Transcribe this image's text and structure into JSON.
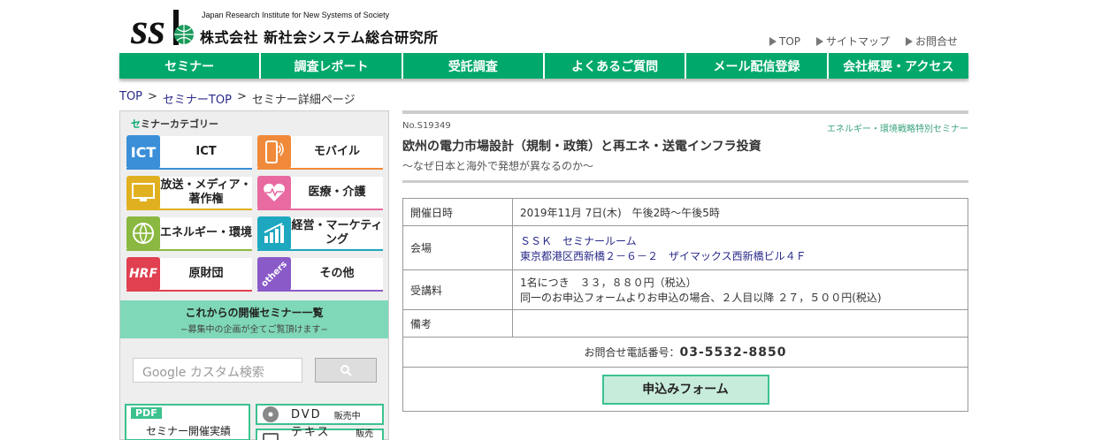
{
  "header": {
    "logo_text": "ssk",
    "org_en": "Japan Research Institute for New Systems of Society",
    "org_jp": "株式会社 新社会システム総合研究所",
    "top_links": [
      "TOP",
      "サイトマップ",
      "お問合せ"
    ]
  },
  "nav": [
    "セミナー",
    "調査レポート",
    "受託調査",
    "よくあるご質問",
    "メール配信登録",
    "会社概要・アクセス"
  ],
  "breadcrumb": {
    "items": [
      "TOP",
      "セミナーTOP",
      "セミナー詳細ページ"
    ],
    "separator": ">"
  },
  "sidebar": {
    "category_title": "セミナーカテゴリー",
    "categories": [
      {
        "label": "ICT",
        "icon": "ict-icon",
        "color": "#3a8fd8"
      },
      {
        "label": "モバイル",
        "icon": "mobile-icon",
        "color": "#f08a3a"
      },
      {
        "label": "放送・メディア・著作権",
        "icon": "monitor-icon",
        "color": "#e0b020"
      },
      {
        "label": "医療・介護",
        "icon": "heart-icon",
        "color": "#e86aa0"
      },
      {
        "label": "エネルギー・環境",
        "icon": "globe-icon",
        "color": "#8ab840"
      },
      {
        "label": "経営・マーケティング",
        "icon": "growth-chart-icon",
        "color": "#1ea8c0"
      },
      {
        "label": "原財団",
        "icon": "hrf-icon",
        "color": "#e04050"
      },
      {
        "label": "その他",
        "icon": "others-icon",
        "color": "#8a5ac8"
      }
    ],
    "upcoming_title": "これからの開催セミナー一覧",
    "upcoming_sub": "−募集中の企画が全てご覧頂けます−",
    "search_placeholder": "Google カスタム検索",
    "pdf_tag": "PDF",
    "pdf_label": "セミナー開催実績",
    "dvd_label": "DVD",
    "dvd_status": "販売中",
    "text_label": "テキスト",
    "text_status": "販売中"
  },
  "seminar": {
    "number": "No.S19349",
    "category": "エネルギー・環境戦略特別セミナー",
    "title": "欧州の電力市場設計（規制・政策）と再エネ・送電インフラ投資",
    "subtitle": "〜なぜ日本と海外で発想が異なるのか〜",
    "rows": {
      "date_label": "開催日時",
      "date_value": "2019年11月 7日(木)　午後2時〜午後5時",
      "venue_label": "会場",
      "venue_name": "ＳＳＫ　セミナールーム",
      "venue_address": "東京都港区西新橋２－６－２　ザイマックス西新橋ビル４Ｆ",
      "fee_label": "受講料",
      "fee_line1": "1名につき　３３，８８０円（税込）",
      "fee_line2": "同一のお申込フォームよりお申込の場合、２人目以降 ２７，５００円(税込)",
      "notes_label": "備考",
      "notes_value": ""
    },
    "phone_label": "お問合せ電話番号：",
    "phone_number": "03-5532-8850",
    "apply_label": "申込みフォーム"
  },
  "colors": {
    "brand_green": "#00a86b",
    "accent_green": "#3cc28f"
  }
}
